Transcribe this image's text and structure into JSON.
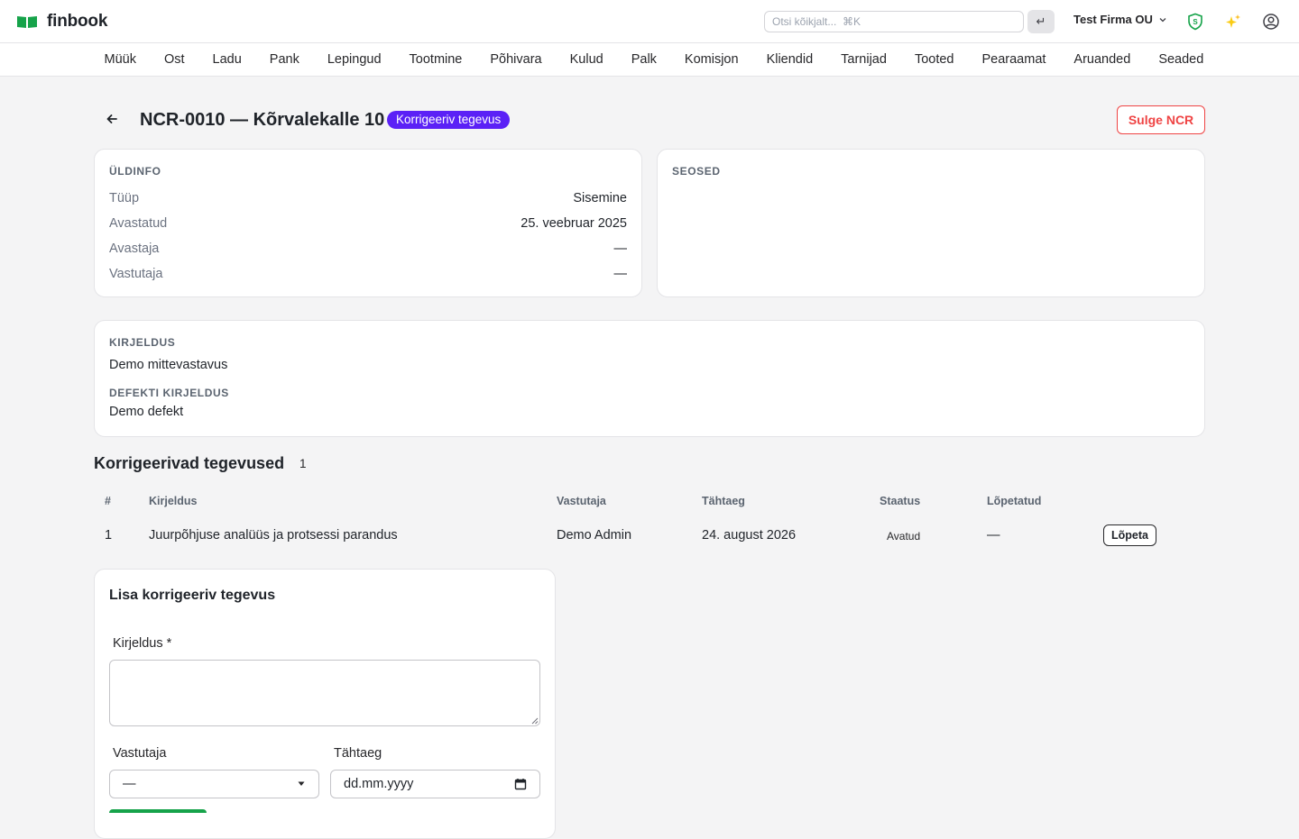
{
  "brand": {
    "name": "finbook",
    "logo_color": "#16a34a"
  },
  "search": {
    "placeholder": "Otsi kõikjalt...  ⌘K"
  },
  "header": {
    "company": "Test Firma OU",
    "enter_icon": "↵"
  },
  "nav": {
    "items": [
      "Müük",
      "Ost",
      "Ladu",
      "Pank",
      "Lepingud",
      "Tootmine",
      "Põhivara",
      "Kulud",
      "Palk",
      "Komisjon",
      "Kliendid",
      "Tarnijad",
      "Tooted",
      "Pearaamat",
      "Aruanded",
      "Seaded"
    ]
  },
  "page": {
    "title": "NCR-0010 — Kõrvalekalle 10",
    "badge": "Korrigeeriv tegevus",
    "badge_color": "#5b21f6",
    "close_button": "Sulge NCR",
    "close_color": "#ef4444"
  },
  "general": {
    "label": "ÜLDINFO",
    "rows": [
      {
        "key": "Tüüp",
        "value": "Sisemine"
      },
      {
        "key": "Avastatud",
        "value": "25. veebruar 2025"
      },
      {
        "key": "Avastaja",
        "value": "—"
      },
      {
        "key": "Vastutaja",
        "value": "—"
      }
    ]
  },
  "links": {
    "label": "SEOSED"
  },
  "description": {
    "label": "KIRJELDUS",
    "value": "Demo mittevastavus",
    "defect_label": "DEFEKTI KIRJELDUS",
    "defect_value": "Demo defekt"
  },
  "actions": {
    "title": "Korrigeerivad tegevused",
    "count": "1",
    "columns": [
      "#",
      "Kirjeldus",
      "Vastutaja",
      "Tähtaeg",
      "Staatus",
      "Lõpetatud"
    ],
    "rows": [
      {
        "num": "1",
        "description": "Juurpõhjuse analüüs ja protsessi parandus",
        "owner": "Demo Admin",
        "deadline": "24. august 2026",
        "status": "Avatud",
        "completed": "—",
        "action": "Lõpeta"
      }
    ]
  },
  "form": {
    "title": "Lisa korrigeeriv tegevus",
    "description_label": "Kirjeldus *",
    "owner_label": "Vastutaja",
    "owner_value": "—",
    "deadline_label": "Tähtaeg",
    "deadline_placeholder": "dd.mm.yyyy",
    "save_color": "#16a34a"
  }
}
